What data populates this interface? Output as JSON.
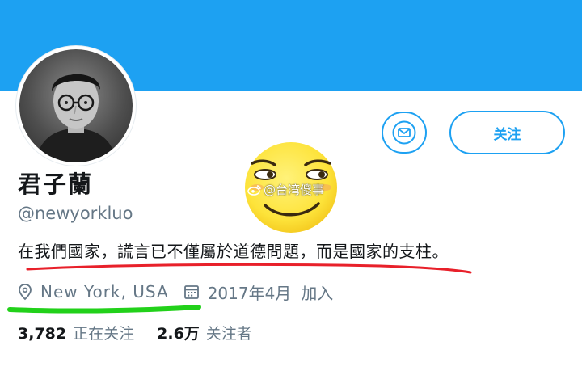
{
  "profile": {
    "display_name": "君子蘭",
    "handle": "@newyorkluo",
    "bio": "在我們國家，謊言已不僅屬於道德問題，而是國家的支柱。",
    "location": "New York, USA",
    "joined_date": "2017年4月",
    "joined_suffix": "加入"
  },
  "actions": {
    "message_icon": "envelope-icon",
    "follow_label": "关注"
  },
  "stats": {
    "following_count": "3,782",
    "following_label": "正在关注",
    "followers_count": "2.6万",
    "followers_label": "关注者"
  },
  "overlay": {
    "watermark": "@台湾傻事"
  },
  "colors": {
    "banner": "#1da1f2",
    "accent": "#1da1f2",
    "secondary_text": "#657786",
    "red_underline": "#e8202a",
    "green_underline": "#22d11a",
    "emoji_face": "#fde33a"
  },
  "icons": {
    "location": "location-pin-icon",
    "calendar": "calendar-icon",
    "emoji": "smirk-emoji-icon"
  }
}
